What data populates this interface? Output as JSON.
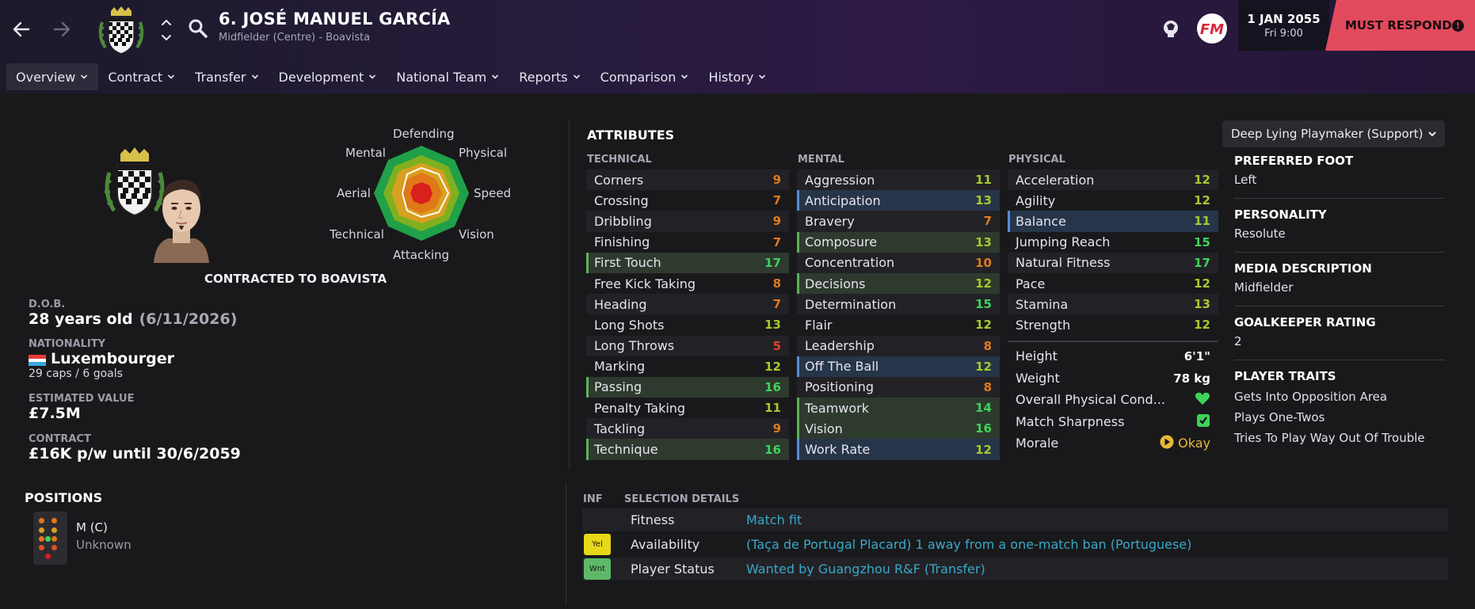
{
  "colors": {
    "attr_high": "#3ed35a",
    "attr_good": "#a6c830",
    "attr_mid": "#e07a1f",
    "attr_low": "#e0452a",
    "link": "#3aa8c8",
    "must_respond": "#e14a5c"
  },
  "header": {
    "player_title": "6. JOSÉ MANUEL GARCÍA",
    "player_subtitle": "Midfielder (Centre) - Boavista",
    "date": "1 JAN 2055",
    "time": "Fri 9:00",
    "must_respond": "MUST RESPOND",
    "alert_glyph": "!"
  },
  "tabs": [
    {
      "label": "Overview"
    },
    {
      "label": "Contract"
    },
    {
      "label": "Transfer"
    },
    {
      "label": "Development"
    },
    {
      "label": "National Team"
    },
    {
      "label": "Reports"
    },
    {
      "label": "Comparison"
    },
    {
      "label": "History"
    }
  ],
  "radar": {
    "labels": {
      "defending": "Defending",
      "physical": "Physical",
      "speed": "Speed",
      "vision": "Vision",
      "attacking": "Attacking",
      "technical": "Technical",
      "aerial": "Aerial",
      "mental": "Mental"
    }
  },
  "profile": {
    "contracted": "CONTRACTED TO BOAVISTA",
    "dob_label": "D.O.B.",
    "age": "28 years old",
    "dob": "(6/11/2026)",
    "nationality_label": "NATIONALITY",
    "nationality": "Luxembourger",
    "caps": "29 caps / 6 goals",
    "value_label": "ESTIMATED VALUE",
    "value": "£7.5M",
    "contract_label": "CONTRACT",
    "contract": "£16K p/w until 30/6/2059"
  },
  "positions": {
    "title": "POSITIONS",
    "position": "M (C)",
    "familiarity": "Unknown"
  },
  "attributes": {
    "title": "ATTRIBUTES",
    "technical_label": "TECHNICAL",
    "mental_label": "MENTAL",
    "physical_label": "PHYSICAL",
    "technical": [
      {
        "name": "Corners",
        "value": "9",
        "hl": ""
      },
      {
        "name": "Crossing",
        "value": "7",
        "hl": ""
      },
      {
        "name": "Dribbling",
        "value": "9",
        "hl": ""
      },
      {
        "name": "Finishing",
        "value": "7",
        "hl": ""
      },
      {
        "name": "First Touch",
        "value": "17",
        "hl": "green"
      },
      {
        "name": "Free Kick Taking",
        "value": "8",
        "hl": ""
      },
      {
        "name": "Heading",
        "value": "7",
        "hl": ""
      },
      {
        "name": "Long Shots",
        "value": "13",
        "hl": ""
      },
      {
        "name": "Long Throws",
        "value": "5",
        "hl": ""
      },
      {
        "name": "Marking",
        "value": "12",
        "hl": ""
      },
      {
        "name": "Passing",
        "value": "16",
        "hl": "green"
      },
      {
        "name": "Penalty Taking",
        "value": "11",
        "hl": ""
      },
      {
        "name": "Tackling",
        "value": "9",
        "hl": ""
      },
      {
        "name": "Technique",
        "value": "16",
        "hl": "green"
      }
    ],
    "mental": [
      {
        "name": "Aggression",
        "value": "11",
        "hl": ""
      },
      {
        "name": "Anticipation",
        "value": "13",
        "hl": "blue"
      },
      {
        "name": "Bravery",
        "value": "7",
        "hl": ""
      },
      {
        "name": "Composure",
        "value": "13",
        "hl": "green"
      },
      {
        "name": "Concentration",
        "value": "10",
        "hl": ""
      },
      {
        "name": "Decisions",
        "value": "12",
        "hl": "green"
      },
      {
        "name": "Determination",
        "value": "15",
        "hl": ""
      },
      {
        "name": "Flair",
        "value": "12",
        "hl": ""
      },
      {
        "name": "Leadership",
        "value": "8",
        "hl": ""
      },
      {
        "name": "Off The Ball",
        "value": "12",
        "hl": "blue"
      },
      {
        "name": "Positioning",
        "value": "8",
        "hl": ""
      },
      {
        "name": "Teamwork",
        "value": "14",
        "hl": "green"
      },
      {
        "name": "Vision",
        "value": "16",
        "hl": "green"
      },
      {
        "name": "Work Rate",
        "value": "12",
        "hl": "blue"
      }
    ],
    "physical": [
      {
        "name": "Acceleration",
        "value": "12",
        "hl": ""
      },
      {
        "name": "Agility",
        "value": "12",
        "hl": ""
      },
      {
        "name": "Balance",
        "value": "11",
        "hl": "blue"
      },
      {
        "name": "Jumping Reach",
        "value": "15",
        "hl": ""
      },
      {
        "name": "Natural Fitness",
        "value": "17",
        "hl": ""
      },
      {
        "name": "Pace",
        "value": "12",
        "hl": ""
      },
      {
        "name": "Stamina",
        "value": "13",
        "hl": ""
      },
      {
        "name": "Strength",
        "value": "12",
        "hl": ""
      }
    ],
    "height_label": "Height",
    "height": "6'1\"",
    "weight_label": "Weight",
    "weight": "78 kg",
    "condition_label": "Overall Physical Cond...",
    "sharpness_label": "Match Sharpness",
    "morale_label": "Morale",
    "morale": "Okay",
    "morale_icon": "play-circle-icon"
  },
  "side": {
    "role": "Deep Lying Playmaker (Support)",
    "foot_label": "PREFERRED FOOT",
    "foot": "Left",
    "personality_label": "PERSONALITY",
    "personality": "Resolute",
    "media_label": "MEDIA DESCRIPTION",
    "media": "Midfielder",
    "gk_label": "GOALKEEPER RATING",
    "gk": "2",
    "traits_label": "PLAYER TRAITS",
    "traits": [
      "Gets Into Opposition Area",
      "Plays One-Twos",
      "Tries To Play Way Out Of Trouble"
    ]
  },
  "selection": {
    "inf_label": "INF",
    "title": "SELECTION DETAILS",
    "rows": [
      {
        "badge": "",
        "badge_color": "",
        "name": "Fitness",
        "value": "Match fit"
      },
      {
        "badge": "Yel",
        "badge_color": "#e8d81a",
        "name": "Availability",
        "value": "(Taça de Portugal Placard) 1 away from a one-match ban (Portuguese)"
      },
      {
        "badge": "Wnt",
        "badge_color": "#5eb868",
        "name": "Player Status",
        "value": "Wanted by Guangzhou R&F (Transfer)"
      }
    ]
  }
}
